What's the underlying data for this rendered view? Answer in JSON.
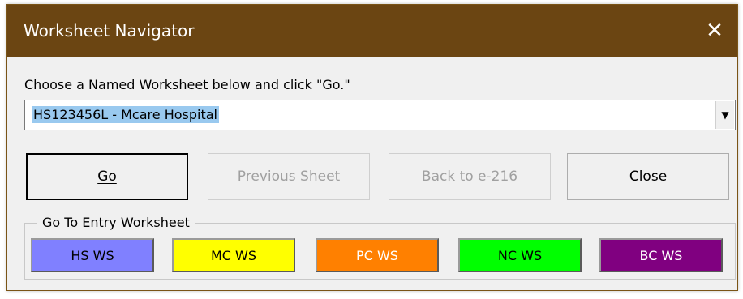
{
  "window": {
    "title": "Worksheet Navigator",
    "close_glyph": "✕"
  },
  "instruction": "Choose a Named Worksheet below and click \"Go.\"",
  "combo": {
    "selected_value": "HS123456L - Mcare Hospital",
    "arrow_glyph": "▼"
  },
  "buttons": {
    "go": "Go",
    "previous": "Previous Sheet",
    "back": "Back to e-216",
    "close": "Close"
  },
  "entry_group": {
    "legend": "Go To Entry Worksheet",
    "items": [
      {
        "label": "HS WS",
        "bg": "#8080ff",
        "fg": "#000000"
      },
      {
        "label": "MC WS",
        "bg": "#ffff00",
        "fg": "#000000"
      },
      {
        "label": "PC WS",
        "bg": "#ff8000",
        "fg": "#ffffff"
      },
      {
        "label": "NC WS",
        "bg": "#00ff00",
        "fg": "#000000"
      },
      {
        "label": "BC WS",
        "bg": "#800080",
        "fg": "#ffffff"
      }
    ]
  },
  "colors": {
    "titlebar": "#6b4512",
    "selection": "#99c9ef"
  }
}
